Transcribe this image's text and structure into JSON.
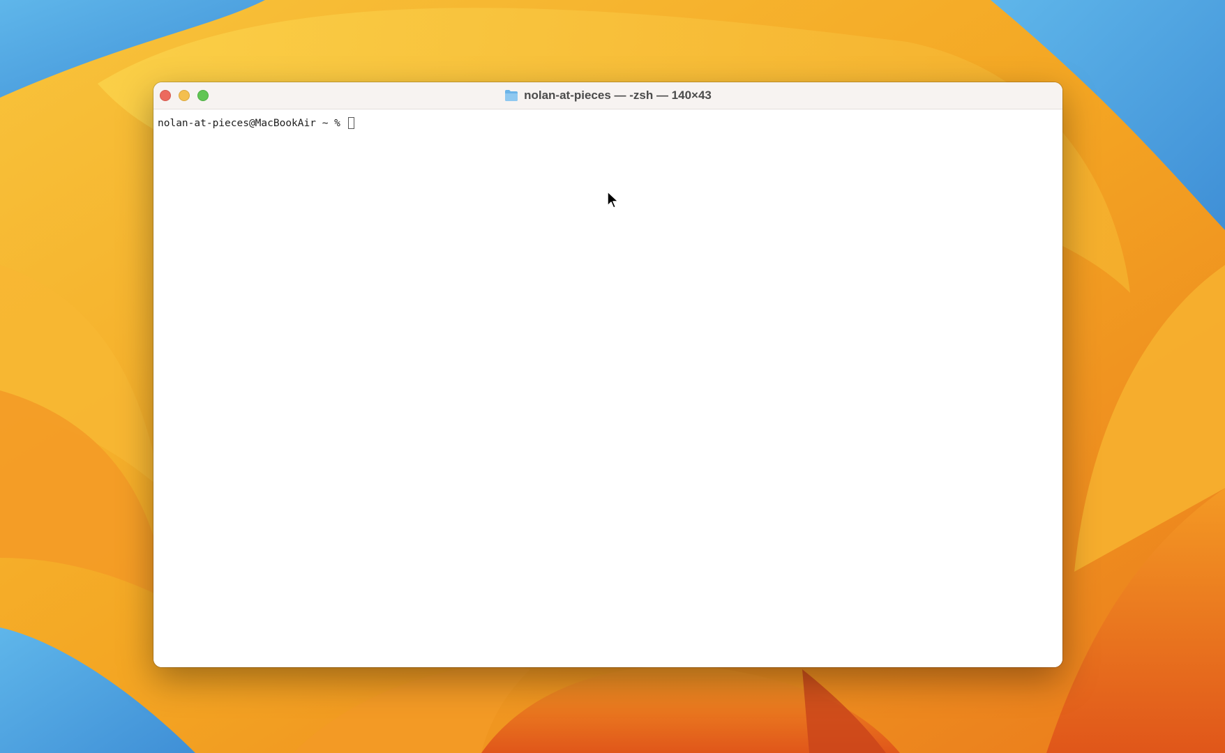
{
  "window": {
    "title": "nolan-at-pieces — -zsh — 140×43",
    "title_icon": "folder-icon",
    "controls": [
      "close",
      "minimize",
      "zoom"
    ]
  },
  "terminal": {
    "prompt": "nolan-at-pieces@MacBookAir ~ % ",
    "cursor": "block-cursor"
  },
  "colors": {
    "close": "#ec6a5e",
    "minimize": "#f4bf4f",
    "zoom": "#61c554",
    "folder": "#6cb4e8"
  }
}
